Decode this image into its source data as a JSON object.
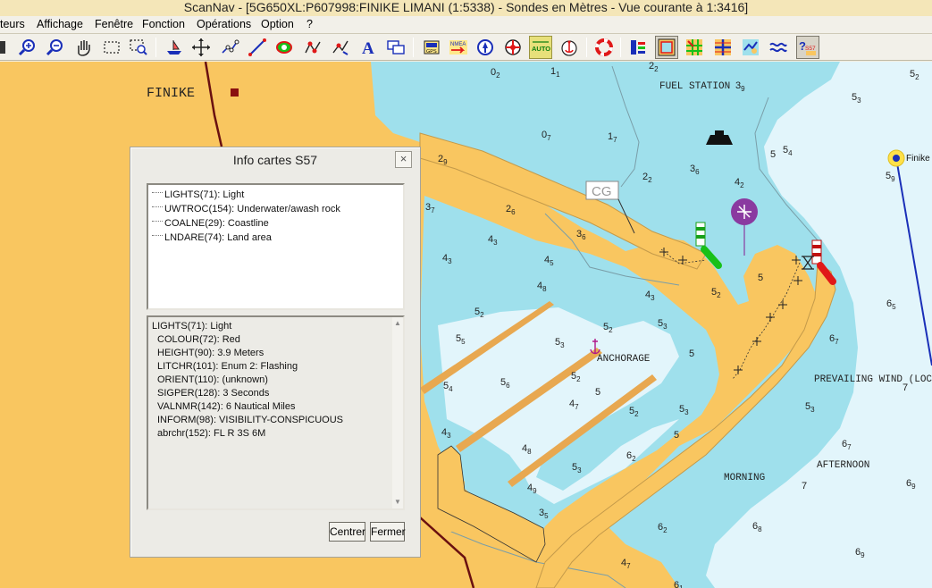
{
  "window": {
    "title": "ScanNav - [5G650XL:P607998:FINIKE LIMANI (1:5338) - Sondes en  Mètres  - Vue courante à 1:3416]"
  },
  "menu": [
    {
      "label": "teurs"
    },
    {
      "label": "Affichage"
    },
    {
      "label": "Fenêtre"
    },
    {
      "label": "Fonction"
    },
    {
      "label": "Opérations"
    },
    {
      "label": "Option"
    },
    {
      "label": "?"
    }
  ],
  "toolbar": {
    "buttons": [
      {
        "icon": "zoom-in-icon"
      },
      {
        "icon": "zoom-out-icon"
      },
      {
        "icon": "hand-pan-icon"
      },
      {
        "icon": "select-rect-icon"
      },
      {
        "icon": "select-zoom-icon"
      },
      {
        "icon": "boat-icon"
      },
      {
        "icon": "center-cross-icon"
      },
      {
        "icon": "route-icon"
      },
      {
        "icon": "measure-icon"
      },
      {
        "icon": "overlay-icon"
      },
      {
        "icon": "waypoint-route-icon"
      },
      {
        "icon": "waypoint-edit-icon"
      },
      {
        "icon": "text-icon"
      },
      {
        "icon": "windows-icon"
      },
      {
        "icon": "gps-icon",
        "text": "GPS"
      },
      {
        "icon": "nmea-icon",
        "text": "NMEA"
      },
      {
        "icon": "north-up-icon"
      },
      {
        "icon": "target-icon"
      },
      {
        "icon": "auto-icon",
        "text": "AUTO"
      },
      {
        "icon": "anchor-alarm-icon"
      },
      {
        "icon": "lifebuoy-icon"
      },
      {
        "icon": "layers-icon"
      },
      {
        "icon": "chart-frame-icon"
      },
      {
        "icon": "grid-icon"
      },
      {
        "icon": "crosshair-grid-icon"
      },
      {
        "icon": "wind-icon"
      },
      {
        "icon": "current-icon"
      },
      {
        "icon": "arrow-right-icon"
      },
      {
        "icon": "s57-info-icon",
        "text": "S57"
      }
    ]
  },
  "map": {
    "labels": {
      "place": "FINIKE",
      "fuel": "FUEL STATION",
      "anchorage": "ANCHORAGE",
      "prevailing": "PREVAILING WIND (LOC",
      "morning": "MORNING",
      "afternoon": "AFTERNOON",
      "finike_marker": "Finike",
      "cg": "CG"
    },
    "soundings": [
      {
        "v": "0",
        "s": "2"
      },
      {
        "v": "1",
        "s": "1"
      },
      {
        "v": "2",
        "s": "2"
      },
      {
        "v": "3",
        "s": "9"
      },
      {
        "v": "5",
        "s": "3"
      },
      {
        "v": "5",
        "s": "2"
      },
      {
        "v": "0",
        "s": "7"
      },
      {
        "v": "1",
        "s": "7"
      },
      {
        "v": "5",
        "s": ""
      },
      {
        "v": "5",
        "s": "4"
      },
      {
        "v": "2",
        "s": "9"
      },
      {
        "v": "3",
        "s": "6"
      },
      {
        "v": "4",
        "s": "2"
      },
      {
        "v": "2",
        "s": "2"
      },
      {
        "v": "5",
        "s": "9"
      },
      {
        "v": "3",
        "s": "7"
      },
      {
        "v": "2",
        "s": "6"
      },
      {
        "v": "3",
        "s": "6"
      },
      {
        "v": "4",
        "s": "3"
      },
      {
        "v": "4",
        "s": "3"
      },
      {
        "v": "4",
        "s": "5"
      },
      {
        "v": "4",
        "s": "8"
      },
      {
        "v": "4",
        "s": "3"
      },
      {
        "v": "5",
        "s": "2"
      },
      {
        "v": "5",
        "s": ""
      },
      {
        "v": "6",
        "s": "5"
      },
      {
        "v": "5",
        "s": "2"
      },
      {
        "v": "5",
        "s": "2"
      },
      {
        "v": "5",
        "s": "3"
      },
      {
        "v": "5",
        "s": "5"
      },
      {
        "v": "5",
        "s": "3"
      },
      {
        "v": "5",
        "s": ""
      },
      {
        "v": "6",
        "s": "7"
      },
      {
        "v": "5",
        "s": "4"
      },
      {
        "v": "5",
        "s": "6"
      },
      {
        "v": "5",
        "s": "2"
      },
      {
        "v": "4",
        "s": "7"
      },
      {
        "v": "5",
        "s": ""
      },
      {
        "v": "5",
        "s": "2"
      },
      {
        "v": "5",
        "s": "3"
      },
      {
        "v": "5",
        "s": ""
      },
      {
        "v": "5",
        "s": "3"
      },
      {
        "v": "7",
        "s": ""
      },
      {
        "v": "4",
        "s": "3"
      },
      {
        "v": "4",
        "s": "8"
      },
      {
        "v": "6",
        "s": "2"
      },
      {
        "v": "6",
        "s": "7"
      },
      {
        "v": "5",
        "s": "3"
      },
      {
        "v": "4",
        "s": "9"
      },
      {
        "v": "3",
        "s": "5"
      },
      {
        "v": "6",
        "s": "2"
      },
      {
        "v": "6",
        "s": "8"
      },
      {
        "v": "7",
        "s": ""
      },
      {
        "v": "6",
        "s": "9"
      },
      {
        "v": "4",
        "s": "7"
      },
      {
        "v": "6",
        "s": "9"
      },
      {
        "v": "6",
        "s": "1"
      }
    ]
  },
  "dialog": {
    "title": "Info cartes S57",
    "close": "×",
    "tree": [
      "LIGHTS(71): Light",
      "UWTROC(154): Underwater/awash rock",
      "COALNE(29): Coastline",
      "LNDARE(74): Land area"
    ],
    "attributes_header": "LIGHTS(71): Light",
    "attributes": [
      "COLOUR(72): Red",
      "HEIGHT(90): 3.9 Meters",
      "LITCHR(101): Enum 2: Flashing",
      "ORIENT(110): (unknown)",
      "SIGPER(128): 3 Seconds",
      "VALNMR(142): 6 Nautical Miles",
      "INFORM(98): VISIBILITY-CONSPICUOUS",
      "abrchr(152): FL R 3S 6M"
    ],
    "btn_center": "Centrer",
    "btn_close": "Fermer"
  },
  "colors": {
    "land": "#f9c660",
    "shallow": "#9fe0ec",
    "deep": "#e2f5fb",
    "mid": "#c5ecf4",
    "quay": "#e8a850",
    "route": "#1a2fb8",
    "light_red": "#e01818",
    "light_green": "#18c018"
  }
}
